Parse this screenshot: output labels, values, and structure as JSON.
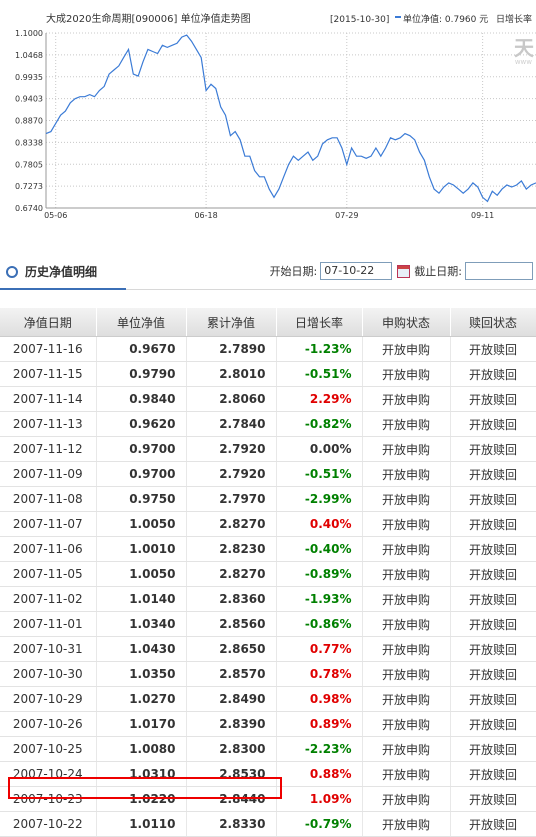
{
  "chart": {
    "title": "大成2020生命周期[090006] 单位净值走势图",
    "date_label": "[2015-10-30]",
    "legend_text": "单位净值: 0.7960 元",
    "legend_tail": "日增长率",
    "logo_text": "天",
    "logo_sub": "www"
  },
  "chart_data": {
    "type": "line",
    "ylim": [
      0.674,
      1.1
    ],
    "yticks": [
      "1.1000",
      "1.0468",
      "0.9935",
      "0.9403",
      "0.8870",
      "0.8338",
      "0.7805",
      "0.7273",
      "0.6740"
    ],
    "xticks": [
      "05-06",
      "06-18",
      "07-29",
      "09-11"
    ],
    "series": [
      {
        "values": [
          0.855,
          0.86,
          0.88,
          0.9,
          0.91,
          0.93,
          0.94,
          0.945,
          0.945,
          0.95,
          0.945,
          0.96,
          0.97,
          1.0,
          1.01,
          1.02,
          1.04,
          1.06,
          1.0,
          0.995,
          1.03,
          1.06,
          1.055,
          1.05,
          1.07,
          1.065,
          1.07,
          1.075,
          1.09,
          1.095,
          1.08,
          1.06,
          1.04,
          0.96,
          0.975,
          0.965,
          0.92,
          0.9,
          0.85,
          0.86,
          0.84,
          0.8,
          0.8,
          0.765,
          0.75,
          0.75,
          0.72,
          0.7,
          0.72,
          0.75,
          0.78,
          0.8,
          0.79,
          0.8,
          0.81,
          0.79,
          0.8,
          0.83,
          0.84,
          0.845,
          0.845,
          0.82,
          0.78,
          0.82,
          0.8,
          0.8,
          0.795,
          0.8,
          0.82,
          0.8,
          0.82,
          0.845,
          0.84,
          0.845,
          0.855,
          0.85,
          0.84,
          0.81,
          0.79,
          0.75,
          0.72,
          0.71,
          0.725,
          0.735,
          0.73,
          0.72,
          0.71,
          0.72,
          0.735,
          0.725,
          0.7,
          0.69,
          0.715,
          0.705,
          0.72,
          0.73,
          0.725,
          0.73,
          0.74,
          0.72,
          0.73,
          0.735
        ]
      }
    ]
  },
  "history": {
    "title": "历史净值明细",
    "start_label": "开始日期:",
    "start_value": "07-10-22",
    "end_label": "截止日期:",
    "end_value": ""
  },
  "table": {
    "headers": [
      "净值日期",
      "单位净值",
      "累计净值",
      "日增长率",
      "申购状态",
      "赎回状态"
    ],
    "rows": [
      {
        "date": "2007-11-16",
        "nav": "0.9670",
        "acc": "2.7890",
        "pct": "-1.23%",
        "dir": "down",
        "buy": "开放申购",
        "redeem": "开放赎回"
      },
      {
        "date": "2007-11-15",
        "nav": "0.9790",
        "acc": "2.8010",
        "pct": "-0.51%",
        "dir": "down",
        "buy": "开放申购",
        "redeem": "开放赎回"
      },
      {
        "date": "2007-11-14",
        "nav": "0.9840",
        "acc": "2.8060",
        "pct": "2.29%",
        "dir": "up",
        "buy": "开放申购",
        "redeem": "开放赎回"
      },
      {
        "date": "2007-11-13",
        "nav": "0.9620",
        "acc": "2.7840",
        "pct": "-0.82%",
        "dir": "down",
        "buy": "开放申购",
        "redeem": "开放赎回"
      },
      {
        "date": "2007-11-12",
        "nav": "0.9700",
        "acc": "2.7920",
        "pct": "0.00%",
        "dir": "flat",
        "buy": "开放申购",
        "redeem": "开放赎回"
      },
      {
        "date": "2007-11-09",
        "nav": "0.9700",
        "acc": "2.7920",
        "pct": "-0.51%",
        "dir": "down",
        "buy": "开放申购",
        "redeem": "开放赎回"
      },
      {
        "date": "2007-11-08",
        "nav": "0.9750",
        "acc": "2.7970",
        "pct": "-2.99%",
        "dir": "down",
        "buy": "开放申购",
        "redeem": "开放赎回"
      },
      {
        "date": "2007-11-07",
        "nav": "1.0050",
        "acc": "2.8270",
        "pct": "0.40%",
        "dir": "up",
        "buy": "开放申购",
        "redeem": "开放赎回"
      },
      {
        "date": "2007-11-06",
        "nav": "1.0010",
        "acc": "2.8230",
        "pct": "-0.40%",
        "dir": "down",
        "buy": "开放申购",
        "redeem": "开放赎回"
      },
      {
        "date": "2007-11-05",
        "nav": "1.0050",
        "acc": "2.8270",
        "pct": "-0.89%",
        "dir": "down",
        "buy": "开放申购",
        "redeem": "开放赎回"
      },
      {
        "date": "2007-11-02",
        "nav": "1.0140",
        "acc": "2.8360",
        "pct": "-1.93%",
        "dir": "down",
        "buy": "开放申购",
        "redeem": "开放赎回"
      },
      {
        "date": "2007-11-01",
        "nav": "1.0340",
        "acc": "2.8560",
        "pct": "-0.86%",
        "dir": "down",
        "buy": "开放申购",
        "redeem": "开放赎回"
      },
      {
        "date": "2007-10-31",
        "nav": "1.0430",
        "acc": "2.8650",
        "pct": "0.77%",
        "dir": "up",
        "buy": "开放申购",
        "redeem": "开放赎回"
      },
      {
        "date": "2007-10-30",
        "nav": "1.0350",
        "acc": "2.8570",
        "pct": "0.78%",
        "dir": "up",
        "buy": "开放申购",
        "redeem": "开放赎回"
      },
      {
        "date": "2007-10-29",
        "nav": "1.0270",
        "acc": "2.8490",
        "pct": "0.98%",
        "dir": "up",
        "buy": "开放申购",
        "redeem": "开放赎回"
      },
      {
        "date": "2007-10-26",
        "nav": "1.0170",
        "acc": "2.8390",
        "pct": "0.89%",
        "dir": "up",
        "buy": "开放申购",
        "redeem": "开放赎回"
      },
      {
        "date": "2007-10-25",
        "nav": "1.0080",
        "acc": "2.8300",
        "pct": "-2.23%",
        "dir": "down",
        "buy": "开放申购",
        "redeem": "开放赎回"
      },
      {
        "date": "2007-10-24",
        "nav": "1.0310",
        "acc": "2.8530",
        "pct": "0.88%",
        "dir": "up",
        "buy": "开放申购",
        "redeem": "开放赎回"
      },
      {
        "date": "2007-10-23",
        "nav": "1.0220",
        "acc": "2.8440",
        "pct": "1.09%",
        "dir": "up",
        "buy": "开放申购",
        "redeem": "开放赎回"
      },
      {
        "date": "2007-10-22",
        "nav": "1.0110",
        "acc": "2.8330",
        "pct": "-0.79%",
        "dir": "down",
        "buy": "开放申购",
        "redeem": "开放赎回"
      }
    ]
  },
  "colors": {
    "line": "#3b7bd6",
    "up": "#e00000",
    "down": "#008000",
    "highlight": "#ee0000"
  }
}
